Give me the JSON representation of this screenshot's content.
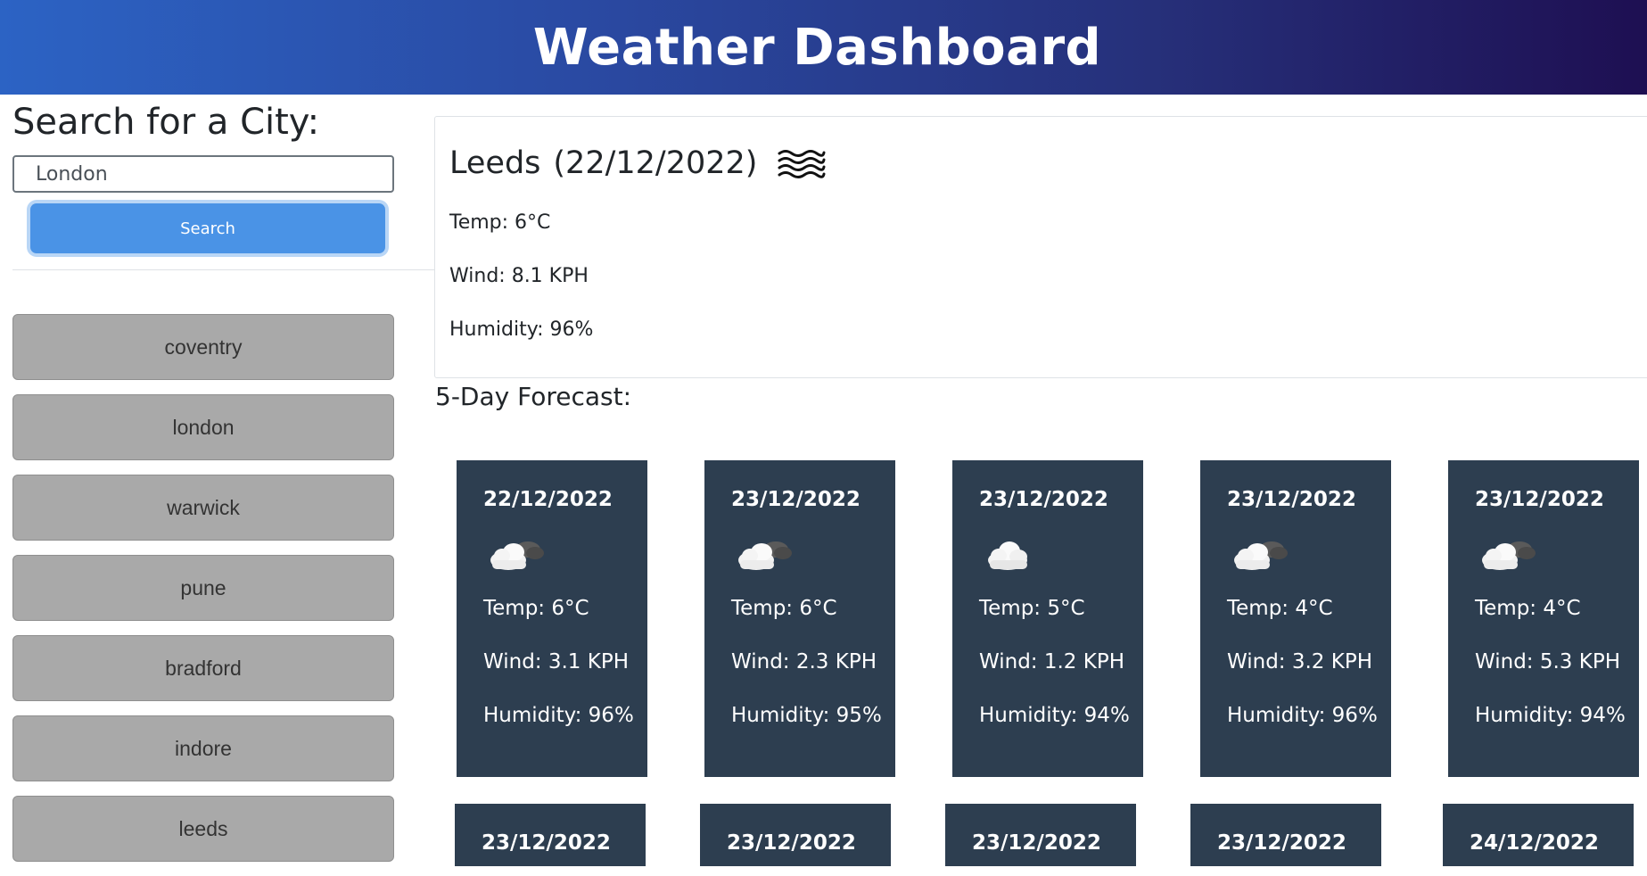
{
  "header": {
    "title": "Weather Dashboard"
  },
  "search": {
    "title": "Search for a City:",
    "input_value": "London",
    "button_label": "Search"
  },
  "history": [
    "coventry",
    "london",
    "warwick",
    "pune",
    "bradford",
    "indore",
    "leeds"
  ],
  "current": {
    "city": "Leeds",
    "date": "(22/12/2022)",
    "icon": "mist-icon",
    "temp": "Temp: 6°C",
    "wind": "Wind: 8.1 KPH",
    "humidity": "Humidity: 96%"
  },
  "forecast": {
    "title": "5-Day Forecast:",
    "cards": [
      {
        "date": "22/12/2022",
        "icon": "partly-cloudy-icon",
        "temp": "Temp: 6°C",
        "wind": "Wind: 3.1 KPH",
        "humidity": "Humidity: 96%"
      },
      {
        "date": "23/12/2022",
        "icon": "partly-cloudy-icon",
        "temp": "Temp: 6°C",
        "wind": "Wind: 2.3 KPH",
        "humidity": "Humidity: 95%"
      },
      {
        "date": "23/12/2022",
        "icon": "cloud-icon",
        "temp": "Temp: 5°C",
        "wind": "Wind: 1.2 KPH",
        "humidity": "Humidity: 94%"
      },
      {
        "date": "23/12/2022",
        "icon": "partly-cloudy-icon",
        "temp": "Temp: 4°C",
        "wind": "Wind: 3.2 KPH",
        "humidity": "Humidity: 96%"
      },
      {
        "date": "23/12/2022",
        "icon": "partly-cloudy-icon",
        "temp": "Temp: 4°C",
        "wind": "Wind: 5.3 KPH",
        "humidity": "Humidity: 94%"
      },
      {
        "date": "23/12/2022"
      },
      {
        "date": "23/12/2022"
      },
      {
        "date": "23/12/2022"
      },
      {
        "date": "23/12/2022"
      },
      {
        "date": "24/12/2022"
      }
    ]
  },
  "colors": {
    "header_gradient_start": "#2c63c4",
    "header_gradient_end": "#1e0f52",
    "search_button": "#4a93e6",
    "history_button": "#a9a9a9",
    "forecast_card": "#2d3e50"
  }
}
